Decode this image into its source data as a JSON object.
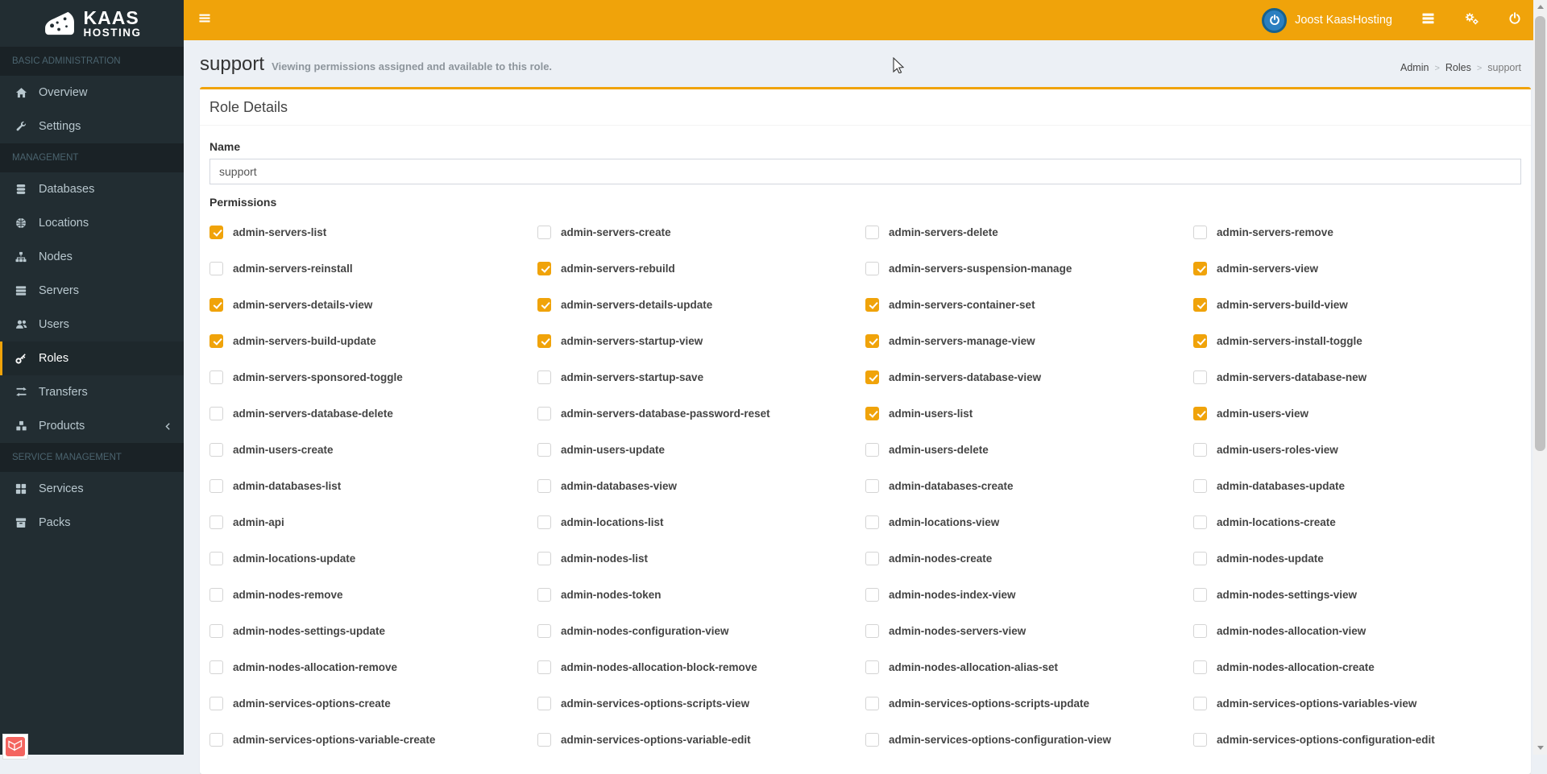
{
  "app": {
    "brand_line1": "KAAS",
    "brand_line2": "HOSTING"
  },
  "topbar": {
    "user_name": "Joost KaasHosting",
    "icons": [
      "menu-bars-icon",
      "tasks-list-icon",
      "gears-icon",
      "power-icon"
    ],
    "accent_color": "#f0a30a"
  },
  "sidebar": {
    "background_color": "#222d32",
    "sections": [
      {
        "label": "BASIC ADMINISTRATION",
        "items": [
          {
            "label": "Overview",
            "icon": "home-icon",
            "active": false
          },
          {
            "label": "Settings",
            "icon": "wrench-icon",
            "active": false
          }
        ]
      },
      {
        "label": "MANAGEMENT",
        "items": [
          {
            "label": "Databases",
            "icon": "database-icon",
            "active": false
          },
          {
            "label": "Locations",
            "icon": "globe-icon",
            "active": false
          },
          {
            "label": "Nodes",
            "icon": "sitemap-icon",
            "active": false
          },
          {
            "label": "Servers",
            "icon": "server-icon",
            "active": false
          },
          {
            "label": "Users",
            "icon": "users-icon",
            "active": false
          },
          {
            "label": "Roles",
            "icon": "key-icon",
            "active": true
          },
          {
            "label": "Transfers",
            "icon": "exchange-icon",
            "active": false
          },
          {
            "label": "Products",
            "icon": "cubes-icon",
            "active": false,
            "has_submenu": true
          }
        ]
      },
      {
        "label": "SERVICE MANAGEMENT",
        "items": [
          {
            "label": "Services",
            "icon": "grid-icon",
            "active": false
          },
          {
            "label": "Packs",
            "icon": "box-icon",
            "active": false
          }
        ]
      }
    ]
  },
  "header": {
    "title": "support",
    "subtitle": "Viewing permissions assigned and available to this role.",
    "breadcrumb": [
      "Admin",
      "Roles",
      "support"
    ]
  },
  "card": {
    "title": "Role Details",
    "name_label": "Name",
    "name_value": "support",
    "permissions_label": "Permissions",
    "checkbox_checked_color": "#f0a30a",
    "permissions": [
      {
        "label": "admin-servers-list",
        "checked": true
      },
      {
        "label": "admin-servers-create",
        "checked": false
      },
      {
        "label": "admin-servers-delete",
        "checked": false
      },
      {
        "label": "admin-servers-remove",
        "checked": false
      },
      {
        "label": "admin-servers-reinstall",
        "checked": false
      },
      {
        "label": "admin-servers-rebuild",
        "checked": true
      },
      {
        "label": "admin-servers-suspension-manage",
        "checked": false
      },
      {
        "label": "admin-servers-view",
        "checked": true
      },
      {
        "label": "admin-servers-details-view",
        "checked": true
      },
      {
        "label": "admin-servers-details-update",
        "checked": true
      },
      {
        "label": "admin-servers-container-set",
        "checked": true
      },
      {
        "label": "admin-servers-build-view",
        "checked": true
      },
      {
        "label": "admin-servers-build-update",
        "checked": true
      },
      {
        "label": "admin-servers-startup-view",
        "checked": true
      },
      {
        "label": "admin-servers-manage-view",
        "checked": true
      },
      {
        "label": "admin-servers-install-toggle",
        "checked": true
      },
      {
        "label": "admin-servers-sponsored-toggle",
        "checked": false
      },
      {
        "label": "admin-servers-startup-save",
        "checked": false
      },
      {
        "label": "admin-servers-database-view",
        "checked": true
      },
      {
        "label": "admin-servers-database-new",
        "checked": false
      },
      {
        "label": "admin-servers-database-delete",
        "checked": false
      },
      {
        "label": "admin-servers-database-password-reset",
        "checked": false
      },
      {
        "label": "admin-users-list",
        "checked": true
      },
      {
        "label": "admin-users-view",
        "checked": true
      },
      {
        "label": "admin-users-create",
        "checked": false
      },
      {
        "label": "admin-users-update",
        "checked": false
      },
      {
        "label": "admin-users-delete",
        "checked": false
      },
      {
        "label": "admin-users-roles-view",
        "checked": false
      },
      {
        "label": "admin-databases-list",
        "checked": false
      },
      {
        "label": "admin-databases-view",
        "checked": false
      },
      {
        "label": "admin-databases-create",
        "checked": false
      },
      {
        "label": "admin-databases-update",
        "checked": false
      },
      {
        "label": "admin-api",
        "checked": false
      },
      {
        "label": "admin-locations-list",
        "checked": false
      },
      {
        "label": "admin-locations-view",
        "checked": false
      },
      {
        "label": "admin-locations-create",
        "checked": false
      },
      {
        "label": "admin-locations-update",
        "checked": false
      },
      {
        "label": "admin-nodes-list",
        "checked": false
      },
      {
        "label": "admin-nodes-create",
        "checked": false
      },
      {
        "label": "admin-nodes-update",
        "checked": false
      },
      {
        "label": "admin-nodes-remove",
        "checked": false
      },
      {
        "label": "admin-nodes-token",
        "checked": false
      },
      {
        "label": "admin-nodes-index-view",
        "checked": false
      },
      {
        "label": "admin-nodes-settings-view",
        "checked": false
      },
      {
        "label": "admin-nodes-settings-update",
        "checked": false
      },
      {
        "label": "admin-nodes-configuration-view",
        "checked": false
      },
      {
        "label": "admin-nodes-servers-view",
        "checked": false
      },
      {
        "label": "admin-nodes-allocation-view",
        "checked": false
      },
      {
        "label": "admin-nodes-allocation-remove",
        "checked": false
      },
      {
        "label": "admin-nodes-allocation-block-remove",
        "checked": false
      },
      {
        "label": "admin-nodes-allocation-alias-set",
        "checked": false
      },
      {
        "label": "admin-nodes-allocation-create",
        "checked": false
      },
      {
        "label": "admin-services-options-create",
        "checked": false
      },
      {
        "label": "admin-services-options-scripts-view",
        "checked": false
      },
      {
        "label": "admin-services-options-scripts-update",
        "checked": false
      },
      {
        "label": "admin-services-options-variables-view",
        "checked": false
      },
      {
        "label": "admin-services-options-variable-create",
        "checked": false
      },
      {
        "label": "admin-services-options-variable-edit",
        "checked": false
      },
      {
        "label": "admin-services-options-configuration-view",
        "checked": false
      },
      {
        "label": "admin-services-options-configuration-edit",
        "checked": false
      }
    ]
  }
}
